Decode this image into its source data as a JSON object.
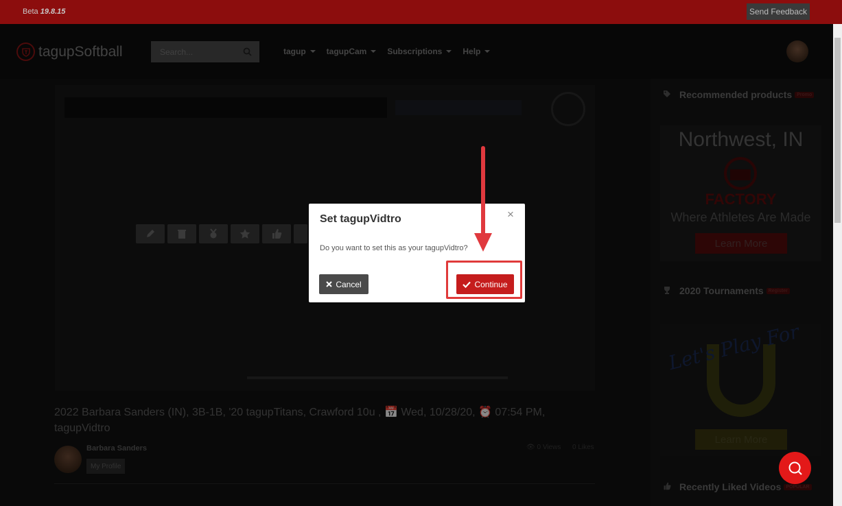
{
  "betabar": {
    "label": "Beta",
    "version": "19.8.15",
    "feedback_label": "Send Feedback"
  },
  "header": {
    "logo_text": "tagupSoftball",
    "search_placeholder": "Search...",
    "nav": [
      {
        "label": "tagup"
      },
      {
        "label": "tagupCam"
      },
      {
        "label": "Subscriptions"
      },
      {
        "label": "Help"
      }
    ]
  },
  "video": {
    "title": "2022 Barbara Sanders (IN), 3B-1B, '20 tagupTitans, Crawford 10u , 📅 Wed, 10/28/20, ⏰ 07:54 PM, tagupVidtro",
    "title_part1": "2022 Barbara Sanders (IN), 3B-1B, '20 tagupTitans, Crawford 10u ,",
    "title_date": "Wed, 10/28/20,",
    "title_time": "07:54 PM,",
    "title_line2": "tagupVidtro",
    "owner_name": "Barbara Sanders",
    "profile_label": "My Profile",
    "views": "0 Views",
    "likes": "0 Likes"
  },
  "sidebar": {
    "recommended": {
      "label": "Recommended products",
      "badge": "Promo"
    },
    "ad1": {
      "title": "Northwest, IN",
      "brand": "FACTORY",
      "tagline": "Where Athletes Are Made",
      "button": "Learn More"
    },
    "tournaments": {
      "label": "2020 Tournaments",
      "badge": "Register"
    },
    "ad2": {
      "script": "Let's Play For",
      "button": "Learn More"
    },
    "liked": {
      "label": "Recently Liked Videos",
      "badge": "POPULAR"
    }
  },
  "modal": {
    "title": "Set tagupVidtro",
    "close": "×",
    "message": "Do you want to set this as your tagupVidtro?",
    "cancel_label": "Cancel",
    "continue_label": "Continue"
  },
  "colors": {
    "accent": "#c51d1d",
    "annotation": "#e03a3a",
    "beta_bar": "#8c0d0d"
  }
}
